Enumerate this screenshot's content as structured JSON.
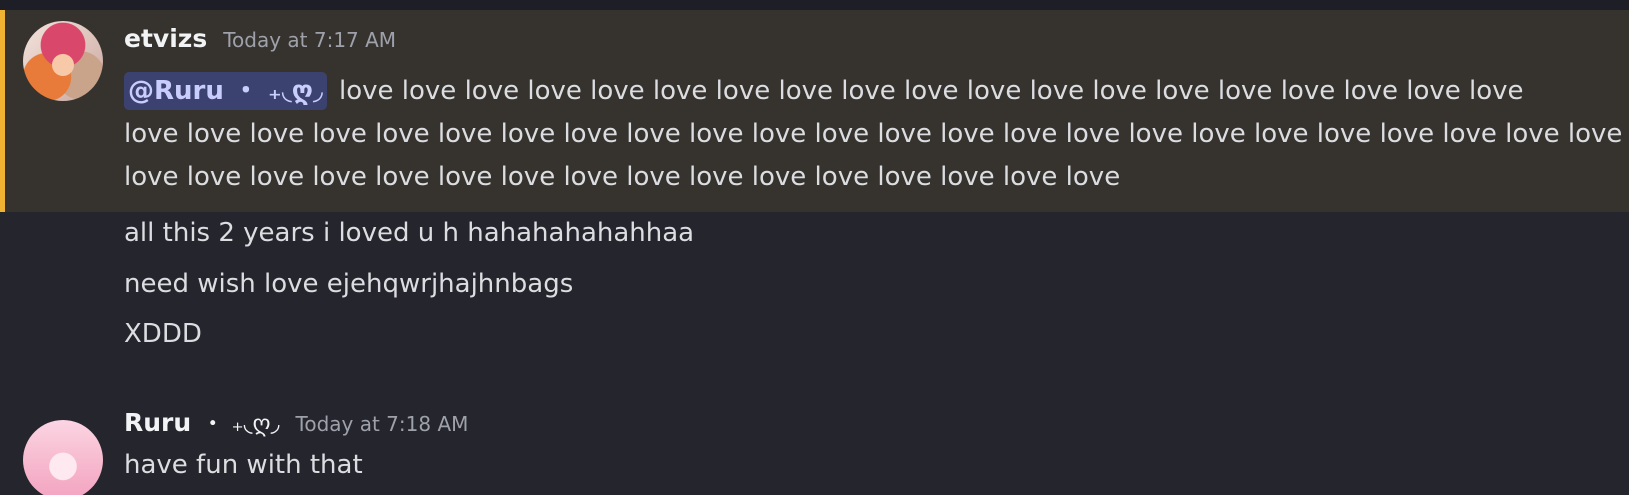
{
  "messages": [
    {
      "author": "etvizs",
      "timestamp": "Today at 7:17 AM",
      "mention": "@Ruru ・ ₊◟ღ◞",
      "text_lines": [
        "love love love love love love love love love love love love love love love love love love love",
        "love love love love love love love love love love love love love love love love love love love love love love love love love",
        "love love love love love love love love love love love love love love love love"
      ]
    }
  ],
  "followups": [
    "all this 2 years i loved u h hahahahahahhaa",
    "need wish love ejehqwrjhajhnbags",
    "XDDD"
  ],
  "reply": {
    "author": "Ruru",
    "author_deco": "・ ₊◟ღ◞",
    "timestamp": "Today at 7:18 AM",
    "text": "have fun with that"
  },
  "colors": {
    "background": "#24252d",
    "mention_highlight": "#36332f",
    "mention_bar": "#f0b232",
    "mention_pill": "#3c4270"
  }
}
